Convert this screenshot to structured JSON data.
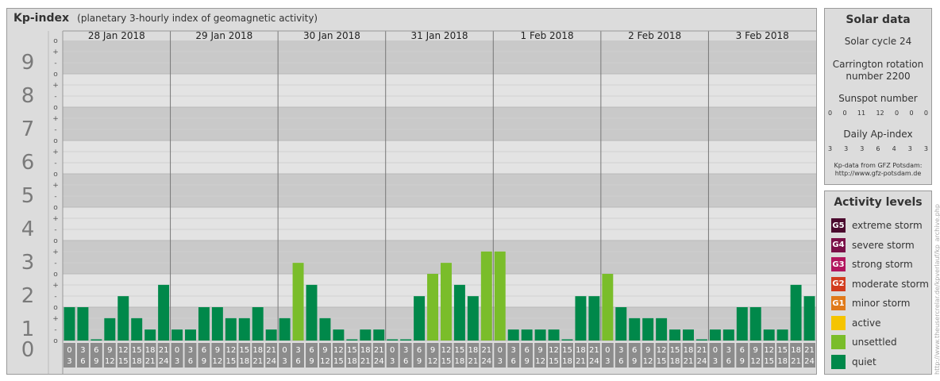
{
  "header": {
    "title": "Kp-index",
    "subtitle": "(planetary 3-hourly index of geomagnetic activity)"
  },
  "chart_data": {
    "type": "bar",
    "title": "Kp-index",
    "subtitle": "(planetary 3-hourly index of geomagnetic activity)",
    "ylim": [
      0,
      9
    ],
    "y_ticks": [
      "0",
      "1",
      "2",
      "3",
      "4",
      "5",
      "6",
      "7",
      "8",
      "9"
    ],
    "y_minor_ticks": [
      "o",
      "+",
      "-"
    ],
    "days": [
      "28 Jan 2018",
      "29 Jan 2018",
      "30 Jan 2018",
      "31 Jan 2018",
      "1 Feb 2018",
      "2 Feb 2018",
      "3 Feb 2018"
    ],
    "hour_ranges": [
      [
        "0",
        "3"
      ],
      [
        "3",
        "6"
      ],
      [
        "6",
        "9"
      ],
      [
        "9",
        "12"
      ],
      [
        "12",
        "15"
      ],
      [
        "15",
        "18"
      ],
      [
        "18",
        "21"
      ],
      [
        "21",
        "24"
      ]
    ],
    "values": [
      [
        1,
        1,
        0,
        0.67,
        1.33,
        0.67,
        0.33,
        1.67
      ],
      [
        0.33,
        0.33,
        1,
        1,
        0.67,
        0.67,
        1,
        0.33
      ],
      [
        0.67,
        2.33,
        1.67,
        0.67,
        0.33,
        0,
        0.33,
        0.33
      ],
      [
        0,
        0,
        1.33,
        2,
        2.33,
        1.67,
        1.33,
        2.67
      ],
      [
        2.67,
        0.33,
        0.33,
        0.33,
        0.33,
        0,
        1.33,
        1.33
      ],
      [
        2,
        1,
        0.67,
        0.67,
        0.67,
        0.33,
        0.33,
        0
      ],
      [
        0.33,
        0.33,
        1,
        1,
        0.33,
        0.33,
        1.67,
        1.33
      ]
    ],
    "levels": [
      [
        0,
        "quiet"
      ],
      [
        2,
        "unsettled"
      ],
      [
        3,
        "active"
      ]
    ],
    "level_colors": {
      "quiet": "#00884a",
      "unsettled": "#7abd2a",
      "active": "#f5c400"
    },
    "grid": true,
    "legend_position": "right"
  },
  "solar": {
    "title": "Solar data",
    "cycle": "Solar cycle 24",
    "carrington_1": "Carrington rotation",
    "carrington_2": "number 2200",
    "sunspot_label": "Sunspot number",
    "sunspot_values": [
      "0",
      "0",
      "11",
      "12",
      "0",
      "0",
      "0"
    ],
    "ap_label": "Daily Ap-index",
    "ap_values": [
      "3",
      "3",
      "3",
      "6",
      "4",
      "3",
      "3"
    ],
    "credit_1": "Kp-data from GFZ Potsdam:",
    "credit_2": "http://www.gfz-potsdam.de"
  },
  "activity": {
    "title": "Activity levels",
    "items": [
      {
        "badge": "G5",
        "label": "extreme storm",
        "color": "#4a0a2e"
      },
      {
        "badge": "G4",
        "label": "severe storm",
        "color": "#7a1048"
      },
      {
        "badge": "G3",
        "label": "strong storm",
        "color": "#b2155e"
      },
      {
        "badge": "G2",
        "label": "moderate storm",
        "color": "#d23c1e"
      },
      {
        "badge": "G1",
        "label": "minor storm",
        "color": "#e07a1a"
      },
      {
        "badge": "",
        "label": "active",
        "color": "#f5c400"
      },
      {
        "badge": "",
        "label": "unsettled",
        "color": "#7abd2a"
      },
      {
        "badge": "",
        "label": "quiet",
        "color": "#00884a"
      }
    ]
  },
  "watermark": "http://www.theusercrelar.de/kpverlauf/kp_archive.php"
}
